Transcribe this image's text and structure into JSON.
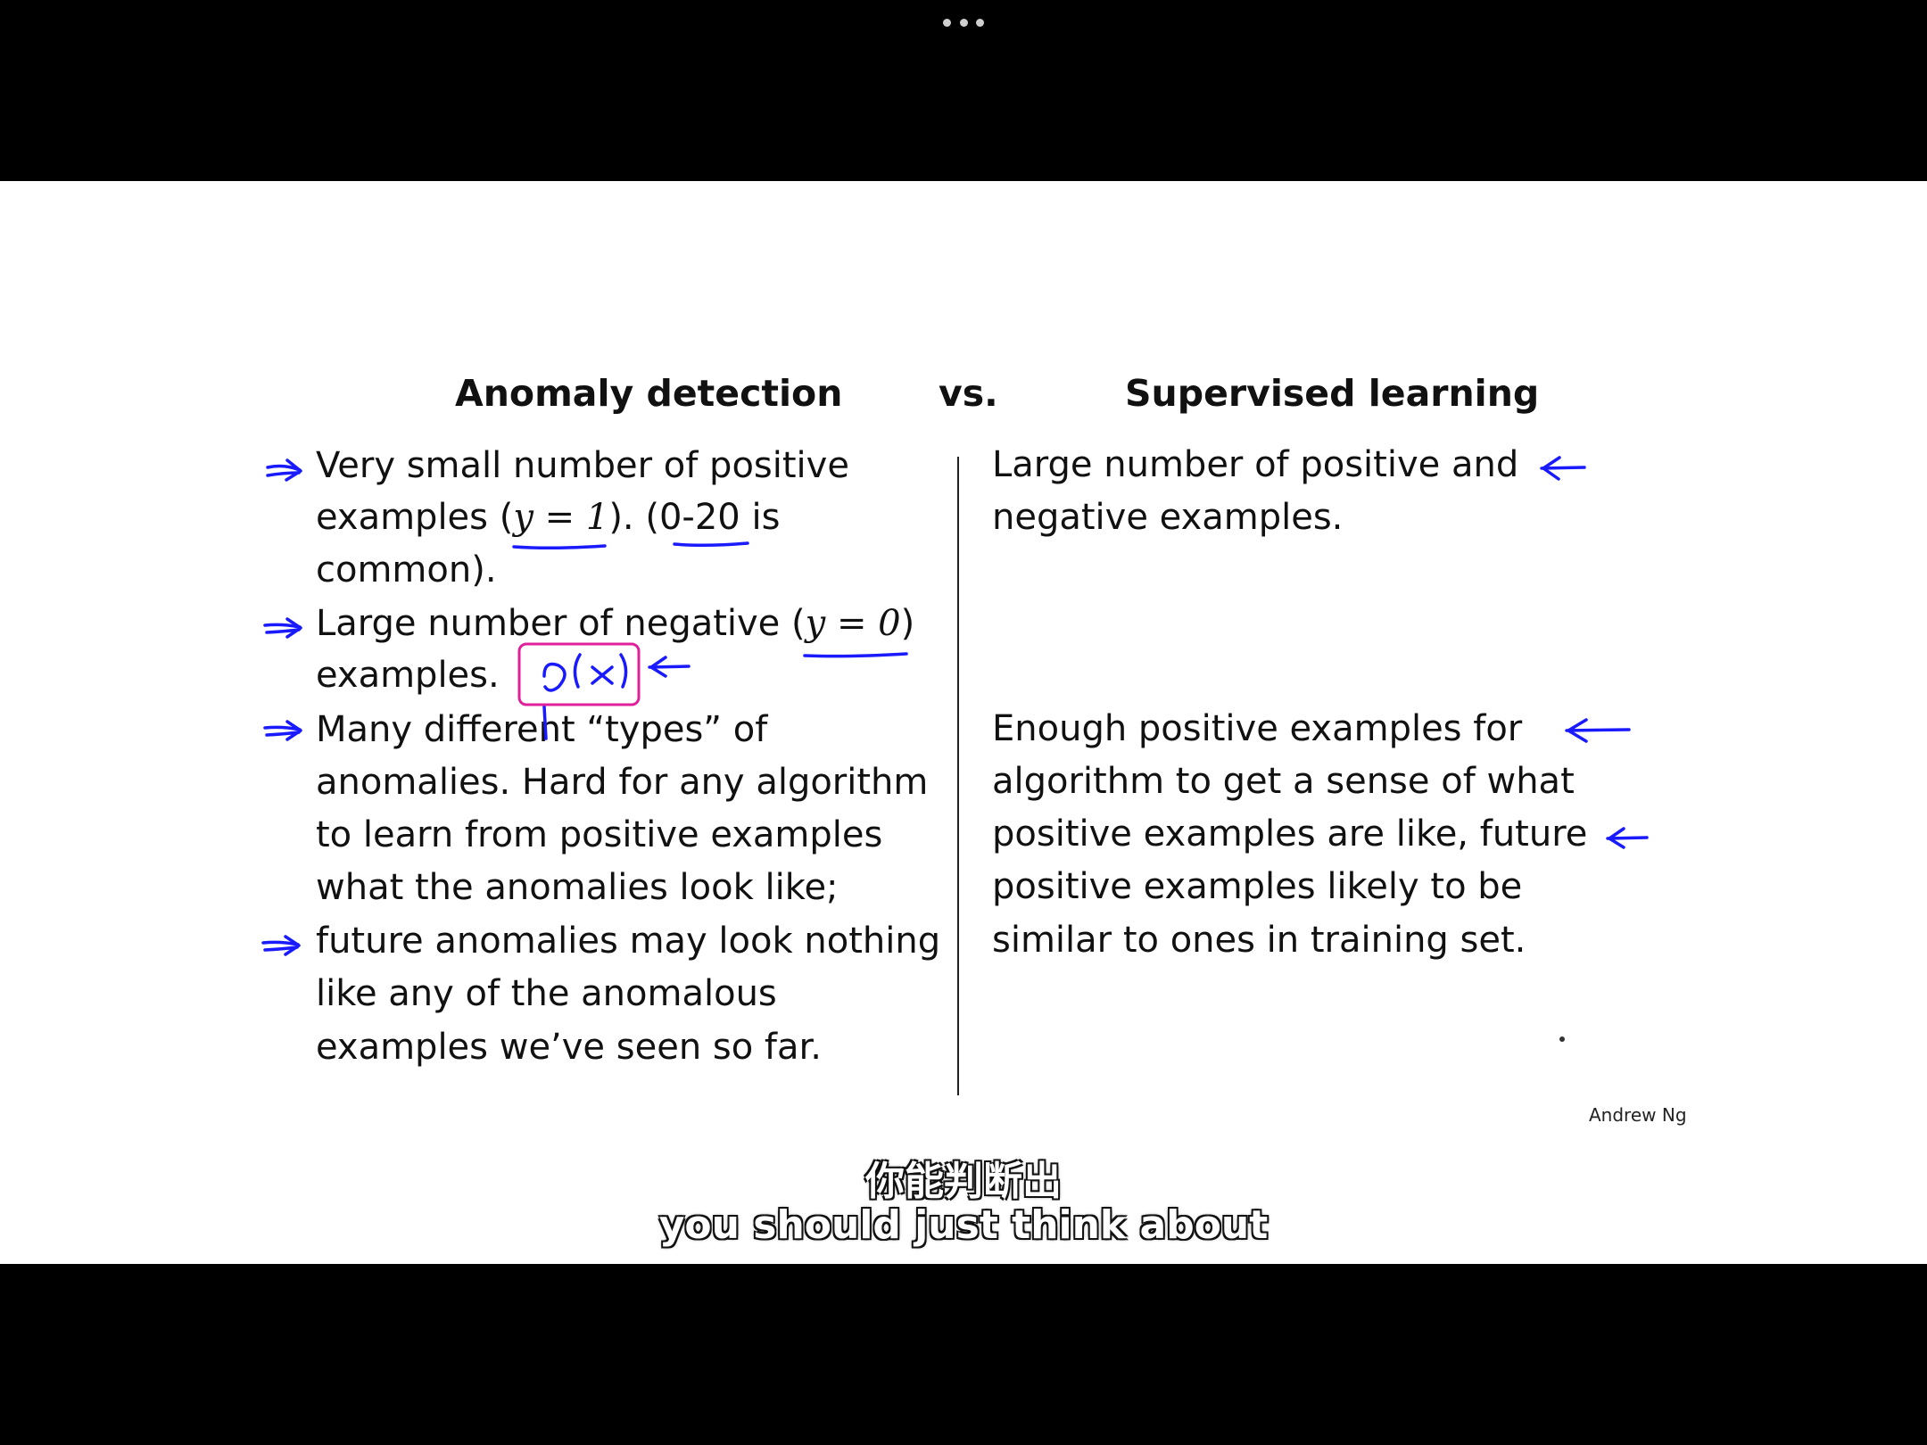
{
  "player": {
    "more_icon": "more-horizontal-icon"
  },
  "slide": {
    "title_left": "Anomaly detection",
    "title_vs": "vs.",
    "title_right": "Supervised learning",
    "left_lines": [
      "Very small number of positive",
      "examples (",
      "y = 1",
      "). (0-20 is",
      "common).",
      "Large number of negative (",
      "y = 0",
      ")",
      "examples.",
      "Many different “types” of",
      "anomalies. Hard for any algorithm",
      "to learn from positive examples",
      "what the anomalies look like;",
      "future anomalies may look nothing",
      "like any of the anomalous",
      "examples we’ve seen so far."
    ],
    "right_lines": [
      "Large number of positive and",
      "negative examples.",
      "Enough positive examples for",
      "algorithm to get a sense of what",
      "positive examples are like,  future",
      "positive examples likely to be",
      "similar to ones in training set."
    ],
    "handwritten_note": "p(x)",
    "credit": "Andrew Ng"
  },
  "subtitles": {
    "zh": "你能判断出",
    "en": "you should just think about"
  },
  "colors": {
    "ink_blue": "#1a1aff",
    "ink_magenta": "#e0209a"
  }
}
